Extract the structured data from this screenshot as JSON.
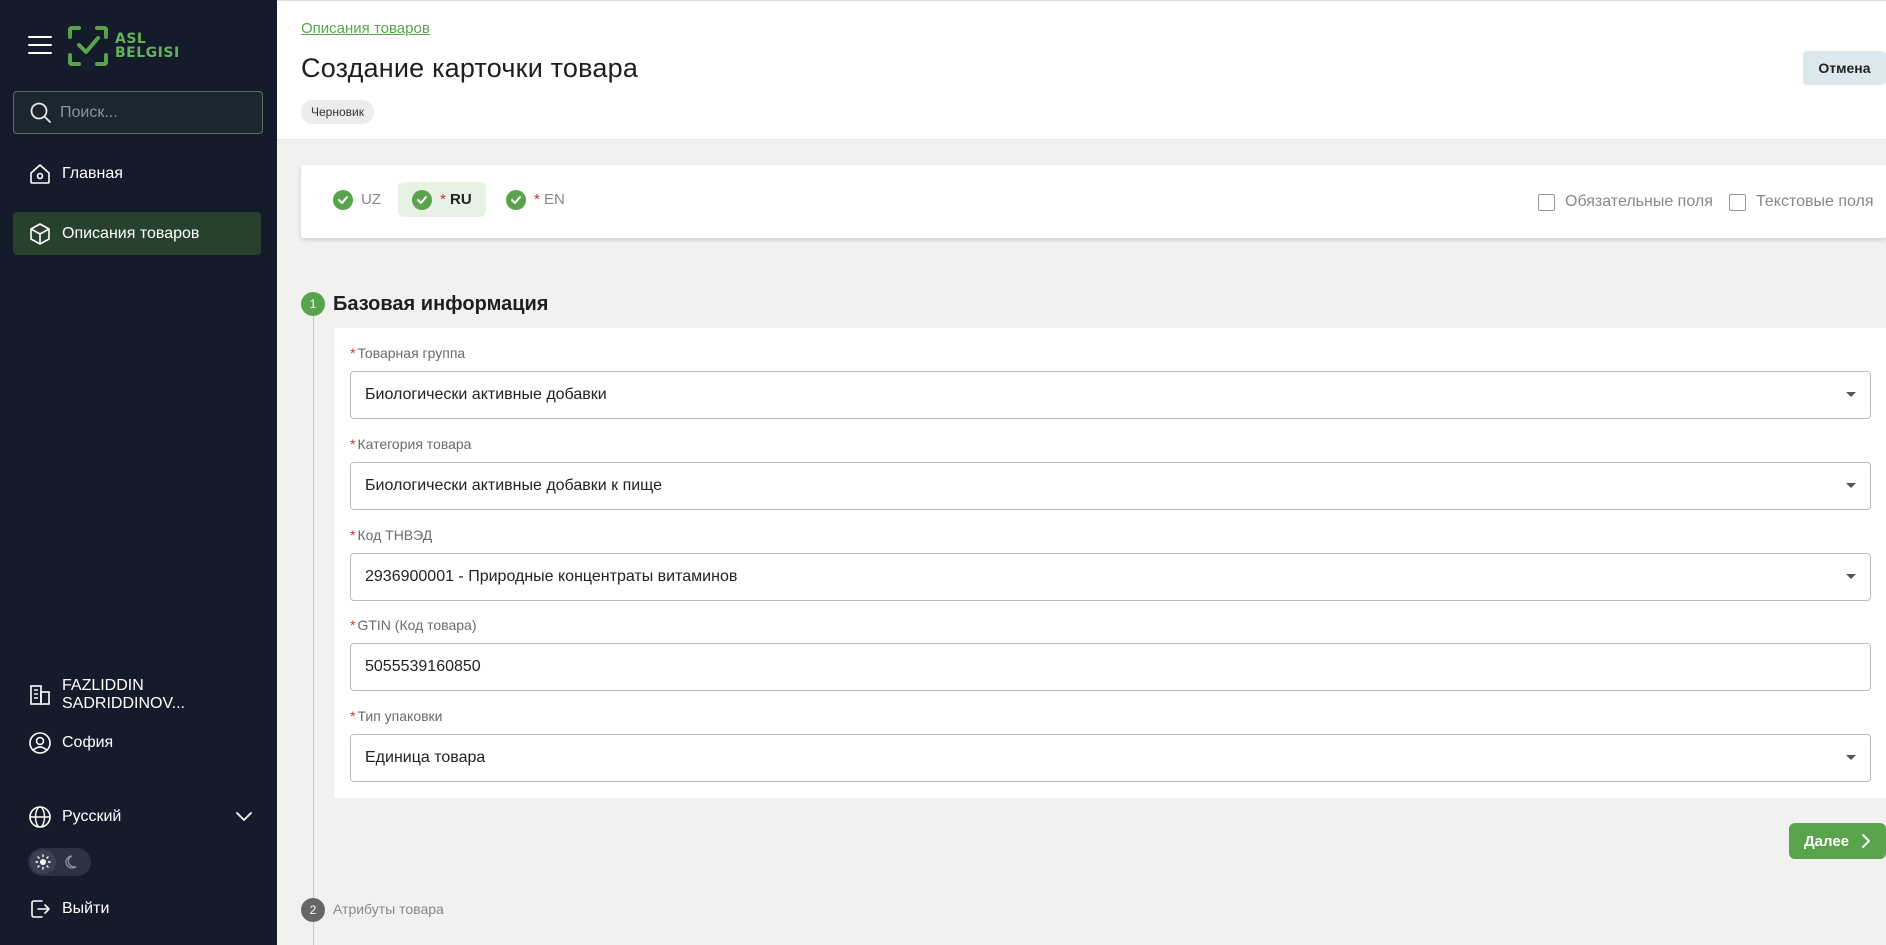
{
  "app": {
    "logo_line1": "ASL",
    "logo_line2": "BELGISI",
    "brand_color": "#5aa34d"
  },
  "sidebar": {
    "search_placeholder": "Поиск...",
    "nav": [
      {
        "label": "Главная",
        "icon": "home-icon"
      },
      {
        "label": "Описания товаров",
        "icon": "box-icon",
        "active": true
      }
    ],
    "company": "FAZLIDDIN SADRIDDINOV...",
    "user": "София",
    "language": "Русский",
    "logout": "Выйти",
    "theme": "light"
  },
  "header": {
    "breadcrumb": "Описания товаров",
    "title": "Создание карточки товара",
    "status_badge": "Черновик",
    "cancel_label": "Отмена"
  },
  "languages": {
    "tabs": [
      {
        "code": "UZ",
        "required": false,
        "complete": true
      },
      {
        "code": "RU",
        "required": true,
        "complete": true,
        "active": true
      },
      {
        "code": "EN",
        "required": true,
        "complete": true
      }
    ],
    "filters": [
      {
        "label": "Обязательные поля",
        "checked": false
      },
      {
        "label": "Текстовые поля",
        "checked": false
      }
    ]
  },
  "step1": {
    "number": "1",
    "title": "Базовая информация",
    "fields": [
      {
        "label": "Товарная группа",
        "value": "Биологически активные добавки",
        "type": "select"
      },
      {
        "label": "Категория товара",
        "value": "Биологически активные добавки к пище",
        "type": "select"
      },
      {
        "label": "Код ТНВЭД",
        "value": "2936900001 - Природные концентраты витаминов",
        "type": "select"
      },
      {
        "label": "GTIN (Код товара)",
        "value": "5055539160850",
        "type": "input"
      },
      {
        "label": "Тип упаковки",
        "value": "Единица товара",
        "type": "select"
      }
    ],
    "next_label": "Далее"
  },
  "step2": {
    "number": "2",
    "title": "Атрибуты товара"
  }
}
